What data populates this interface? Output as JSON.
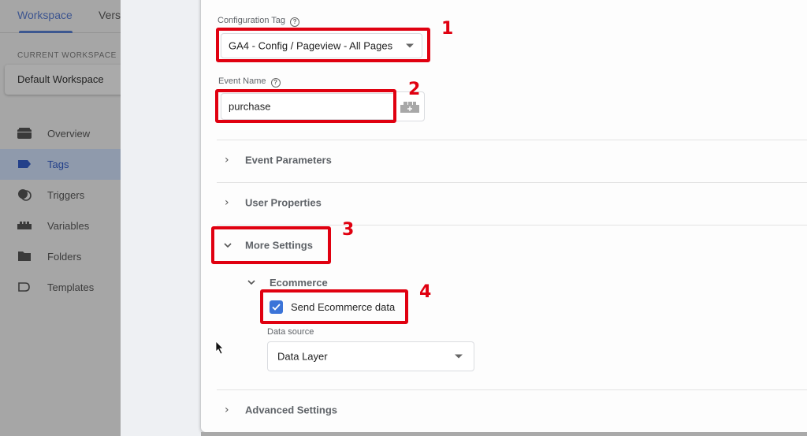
{
  "sidebar": {
    "tabs": [
      {
        "label": "Workspace",
        "active": true
      },
      {
        "label": "Versions",
        "active": false
      }
    ],
    "current_workspace_label": "CURRENT WORKSPACE",
    "current_workspace_name": "Default Workspace",
    "nav_items": [
      {
        "label": "Overview",
        "icon": "briefcase-icon",
        "active": false
      },
      {
        "label": "Tags",
        "icon": "tag-icon",
        "active": true
      },
      {
        "label": "Triggers",
        "icon": "trigger-icon",
        "active": false
      },
      {
        "label": "Variables",
        "icon": "variables-icon",
        "active": false
      },
      {
        "label": "Folders",
        "icon": "folder-icon",
        "active": false
      },
      {
        "label": "Templates",
        "icon": "template-icon",
        "active": false
      }
    ]
  },
  "form": {
    "configuration_tag": {
      "label": "Configuration Tag",
      "value": "GA4 - Config / Pageview - All Pages"
    },
    "event_name": {
      "label": "Event Name",
      "value": "purchase"
    },
    "sections": {
      "event_parameters": "Event Parameters",
      "user_properties": "User Properties",
      "more_settings": "More Settings",
      "advanced_settings": "Advanced Settings"
    },
    "ecommerce": {
      "label": "Ecommerce",
      "send_data_label": "Send Ecommerce data",
      "send_data_checked": true,
      "data_source_label": "Data source",
      "data_source_value": "Data Layer"
    }
  },
  "annotations": {
    "step1": "1",
    "step2": "2",
    "step3": "3",
    "step4": "4",
    "color": "#e00010"
  },
  "colors": {
    "accent": "#3b74d8",
    "active_nav": "#23408a"
  }
}
